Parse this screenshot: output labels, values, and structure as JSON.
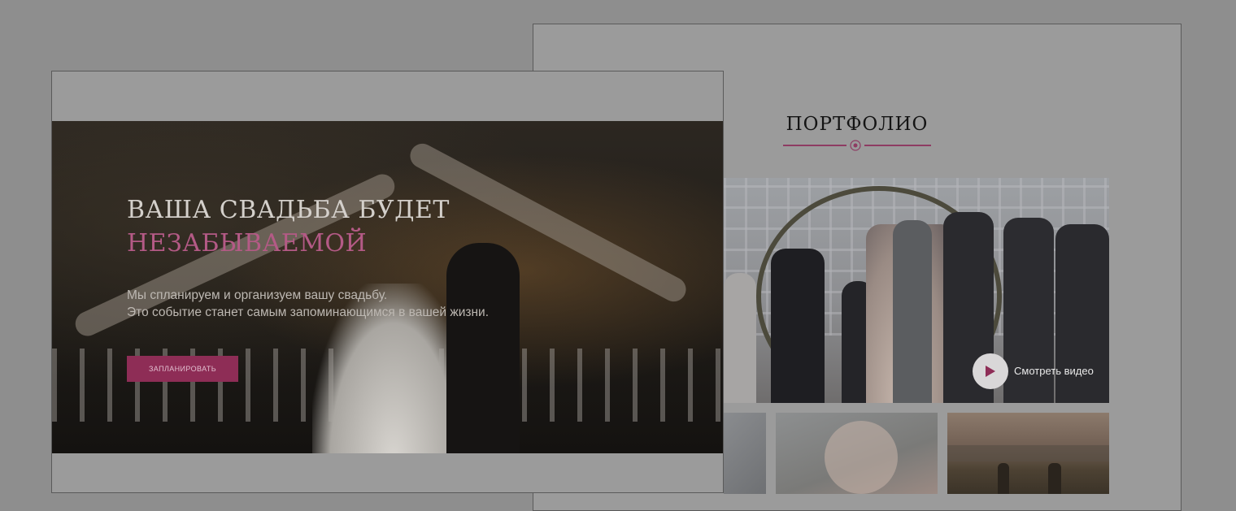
{
  "hero": {
    "title_line1": "ВАША СВАДЬБА БУДЕТ",
    "title_line2": "НЕЗАБЫВАЕМОЙ",
    "description_line1": "Мы спланируем и организуем вашу свадьбу.",
    "description_line2": "Это событие станет самым запоминающимся в вашей жизни.",
    "cta_label": "ЗАПЛАНИРОВАТЬ"
  },
  "portfolio": {
    "title": "ПОРТФОЛИО",
    "video_label": "Смотреть видео",
    "play_icon": "play-icon",
    "divider_icon": "flower-icon"
  },
  "colors": {
    "accent": "#b45a86",
    "button": "#8e2d56",
    "divider": "#8e3c63"
  }
}
